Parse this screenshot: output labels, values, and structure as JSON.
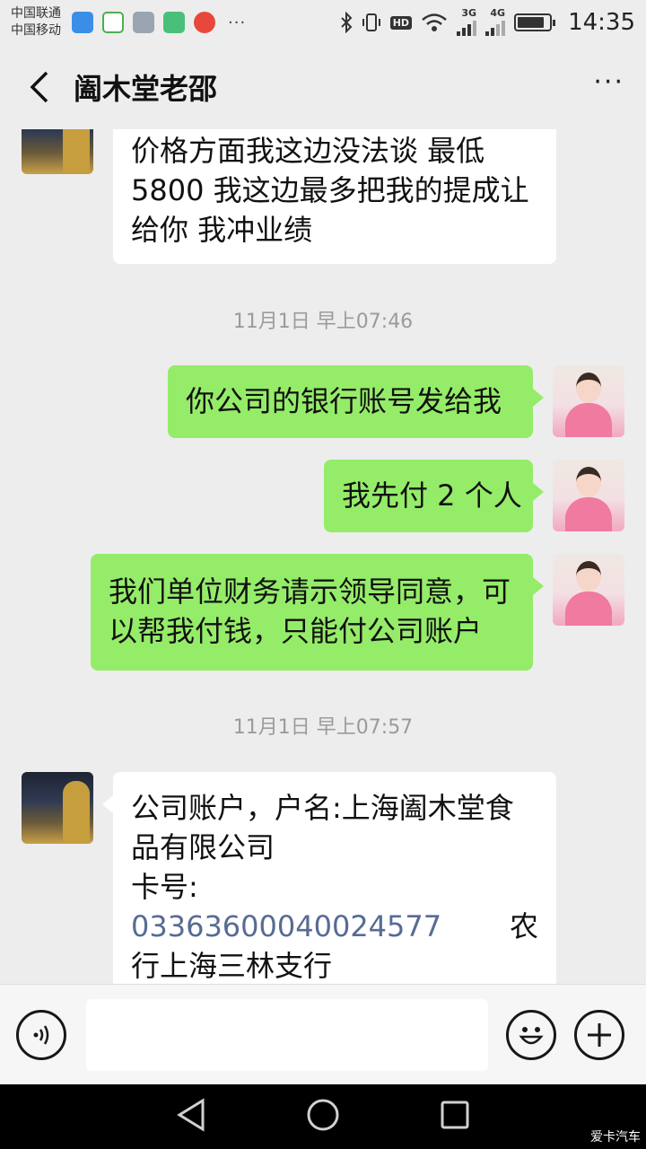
{
  "status_bar": {
    "carrier1": "中国联通",
    "carrier2": "中国移动",
    "dots": "···",
    "hd": "HD",
    "net1": "3G",
    "net2": "4G",
    "time": "14:35",
    "battery_level": 0.85
  },
  "nav": {
    "title": "阖木堂老邵",
    "more_label": "···"
  },
  "messages": {
    "m1": {
      "lines": [
        "价格方面我这边没法谈  最低",
        "5800  我这边最多把我的提成让",
        "给你  我冲业绩"
      ]
    },
    "ts1": "11月1日 早上07:46",
    "m2": "你公司的银行账号发给我",
    "m3": "我先付 2 个人",
    "m4": {
      "lines": [
        "我们单位财务请示领导同意，可",
        "以帮我付钱，只能付公司账户"
      ]
    },
    "ts2": "11月1日 早上07:57",
    "m5": {
      "line1": "公司账户，户名:上海阖木堂食",
      "line2": "品有限公司",
      "line3": "卡号:",
      "account": "03363600040024577",
      "bank_start": "农",
      "line5": "行上海三林支行"
    }
  },
  "watermark": "爱卡汽车",
  "colors": {
    "background": "#ededed",
    "outgoing_bubble": "#95ec69",
    "incoming_bubble": "#ffffff",
    "link": "#576b95"
  }
}
